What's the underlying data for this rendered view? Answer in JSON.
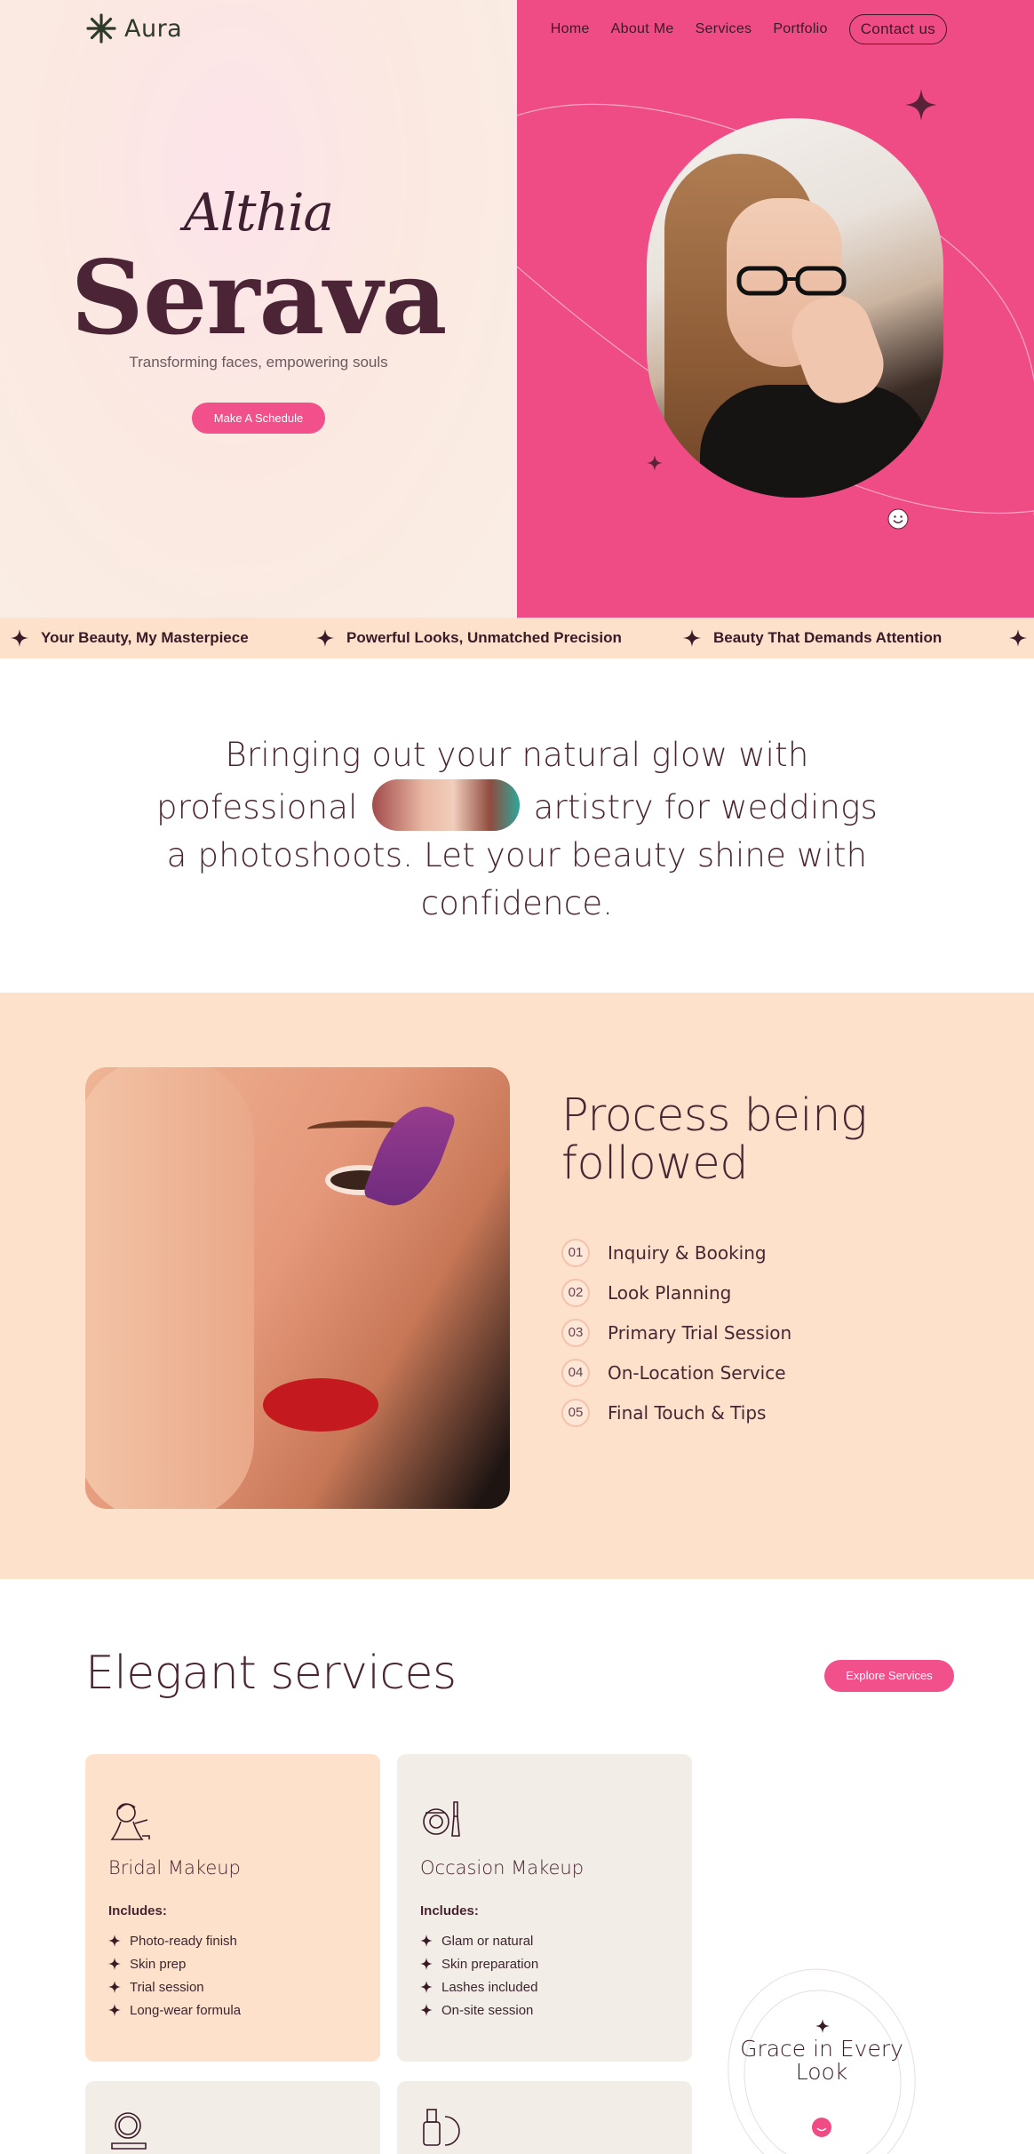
{
  "brand": {
    "name": "Aura"
  },
  "nav": {
    "items": [
      "Home",
      "About Me",
      "Services",
      "Portfolio"
    ],
    "contact": "Contact us"
  },
  "hero": {
    "signature": "Althia",
    "title": "Serava",
    "subtitle": "Transforming faces, empowering souls",
    "cta": "Make A Schedule",
    "accent_color": "#ef4c86"
  },
  "marquee": {
    "items": [
      "Your Beauty, My Masterpiece",
      "Powerful Looks, Unmatched Precision",
      "Beauty That Demands Attention"
    ]
  },
  "intro": {
    "line1": "Bringing out your natural glow with",
    "line2a": "professional",
    "line2b": "artistry for weddings",
    "line3": "a photoshoots. Let your beauty shine with",
    "line4": "confidence."
  },
  "process": {
    "title": "Process being followed",
    "steps": [
      {
        "num": "01",
        "label": "Inquiry & Booking"
      },
      {
        "num": "02",
        "label": "Look Planning"
      },
      {
        "num": "03",
        "label": "Primary Trial Session"
      },
      {
        "num": "04",
        "label": "On-Location Service"
      },
      {
        "num": "05",
        "label": "Final Touch & Tips"
      }
    ]
  },
  "services": {
    "title": "Elegant services",
    "cta": "Explore Services",
    "cards": [
      {
        "icon": "bride-icon",
        "title": "Bridal Makeup",
        "includes": "Includes:",
        "items": [
          "Photo-ready finish",
          "Skin prep",
          "Trial session",
          "Long-wear formula"
        ]
      },
      {
        "icon": "makeup-palette-icon",
        "title": "Occasion Makeup",
        "includes": "Includes:",
        "items": [
          "Glam or natural",
          "Skin preparation",
          "Lashes included",
          "On-site session"
        ]
      }
    ],
    "badge": "Grace in Every Look"
  }
}
